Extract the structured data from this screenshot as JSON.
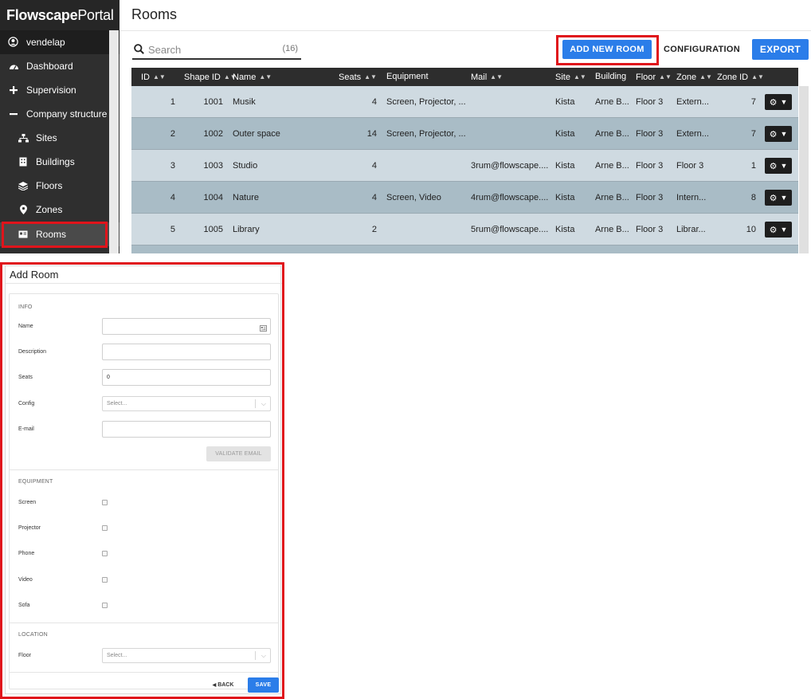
{
  "brand": {
    "bold": "Flowscape",
    "light": "Portal"
  },
  "user": {
    "name": "vendelap"
  },
  "nav": {
    "dashboard": "Dashboard",
    "supervision": "Supervision",
    "company_structure": "Company structure",
    "sites": "Sites",
    "buildings": "Buildings",
    "floors": "Floors",
    "zones": "Zones",
    "rooms": "Rooms"
  },
  "page": {
    "title": "Rooms"
  },
  "search": {
    "placeholder": "Search",
    "count": "(16)"
  },
  "toolbar": {
    "add_new_room": "ADD NEW ROOM",
    "configuration": "CONFIGURATION",
    "export": "EXPORT"
  },
  "table": {
    "headers": {
      "id": "ID",
      "shape_id": "Shape ID",
      "name": "Name",
      "seats": "Seats",
      "equipment": "Equipment",
      "mail": "Mail",
      "site": "Site",
      "building": "Building",
      "floor": "Floor",
      "zone": "Zone",
      "zone_id": "Zone ID"
    },
    "rows": [
      {
        "id": "1",
        "shape_id": "1001",
        "name": "Musik",
        "seats": "4",
        "equipment": "Screen, Projector, ...",
        "mail": "",
        "site": "Kista",
        "building": "Arne B...",
        "floor": "Floor 3",
        "zone": "Extern...",
        "zone_id": "7"
      },
      {
        "id": "2",
        "shape_id": "1002",
        "name": "Outer space",
        "seats": "14",
        "equipment": "Screen, Projector, ...",
        "mail": "",
        "site": "Kista",
        "building": "Arne B...",
        "floor": "Floor 3",
        "zone": "Extern...",
        "zone_id": "7"
      },
      {
        "id": "3",
        "shape_id": "1003",
        "name": "Studio",
        "seats": "4",
        "equipment": "",
        "mail": "3rum@flowscape....",
        "site": "Kista",
        "building": "Arne B...",
        "floor": "Floor 3",
        "zone": "Floor 3",
        "zone_id": "1"
      },
      {
        "id": "4",
        "shape_id": "1004",
        "name": "Nature",
        "seats": "4",
        "equipment": "Screen, Video",
        "mail": "4rum@flowscape....",
        "site": "Kista",
        "building": "Arne B...",
        "floor": "Floor 3",
        "zone": "Intern...",
        "zone_id": "8"
      },
      {
        "id": "5",
        "shape_id": "1005",
        "name": "Library",
        "seats": "2",
        "equipment": "",
        "mail": "5rum@flowscape....",
        "site": "Kista",
        "building": "Arne B...",
        "floor": "Floor 3",
        "zone": "Librar...",
        "zone_id": "10"
      }
    ]
  },
  "dialog": {
    "title": "Add Room",
    "info_heading": "INFO",
    "fields": {
      "name_label": "Name",
      "name_value": "",
      "description_label": "Description",
      "description_value": "",
      "seats_label": "Seats",
      "seats_value": "0",
      "config_label": "Config",
      "config_placeholder": "Select...",
      "email_label": "E-mail",
      "email_value": ""
    },
    "validate_email": "VALIDATE EMAIL",
    "equipment_heading": "EQUIPMENT",
    "equipment": {
      "screen": "Screen",
      "projector": "Projector",
      "phone": "Phone",
      "video": "Video",
      "sofa": "Sofa"
    },
    "location_heading": "LOCATION",
    "floor_label": "Floor",
    "floor_placeholder": "Select...",
    "back": "BACK",
    "save": "SAVE"
  },
  "colors": {
    "accent_blue": "#2b7de9",
    "highlight_red": "#e0141b",
    "sidebar_dark": "#2f2f2f",
    "row_light": "#cfdae1",
    "row_dark": "#a9bcc6"
  }
}
